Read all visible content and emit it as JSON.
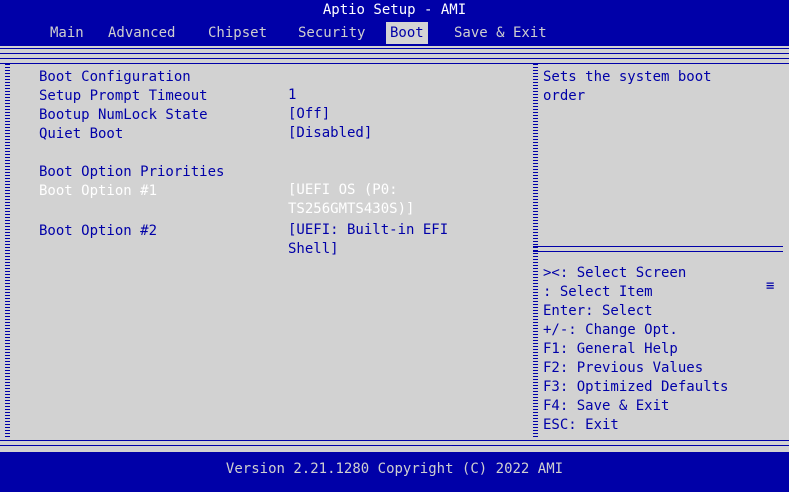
{
  "title": "Aptio Setup - AMI",
  "menu": {
    "items": [
      {
        "label": "Main"
      },
      {
        "label": "Advanced"
      },
      {
        "label": "Chipset"
      },
      {
        "label": "Security"
      },
      {
        "label": "Boot"
      },
      {
        "label": "Save & Exit"
      }
    ],
    "active": "Boot"
  },
  "main": {
    "section_title": "Boot Configuration",
    "settings": [
      {
        "label": "Setup Prompt Timeout",
        "value": "1"
      },
      {
        "label": "Bootup NumLock State",
        "value": "[Off]"
      },
      {
        "label": "Quiet Boot",
        "value": "[Disabled]"
      }
    ],
    "priorities_title": "Boot Option Priorities",
    "boot_options": [
      {
        "label": "Boot Option #1",
        "value_line1": "[UEFI OS (P0:",
        "value_line2": "TS256GMTS430S)]"
      },
      {
        "label": "Boot Option #2",
        "value_line1": "[UEFI: Built-in EFI",
        "value_line2": "Shell]"
      }
    ]
  },
  "help": {
    "description_line1": "Sets the system boot",
    "description_line2": "order",
    "keys": [
      "><: Select Screen",
      ": Select Item",
      "Enter: Select",
      "+/-: Change Opt.",
      "F1: General Help",
      "F2: Previous Values",
      "F3: Optimized Defaults",
      "F4: Save & Exit",
      "ESC: Exit"
    ]
  },
  "footer": "Version 2.21.1280 Copyright (C) 2022 AMI",
  "colors": {
    "background": "#0000a8",
    "panel": "#d2d2d2",
    "text": "#0000a8",
    "highlight": "#ffffff"
  }
}
